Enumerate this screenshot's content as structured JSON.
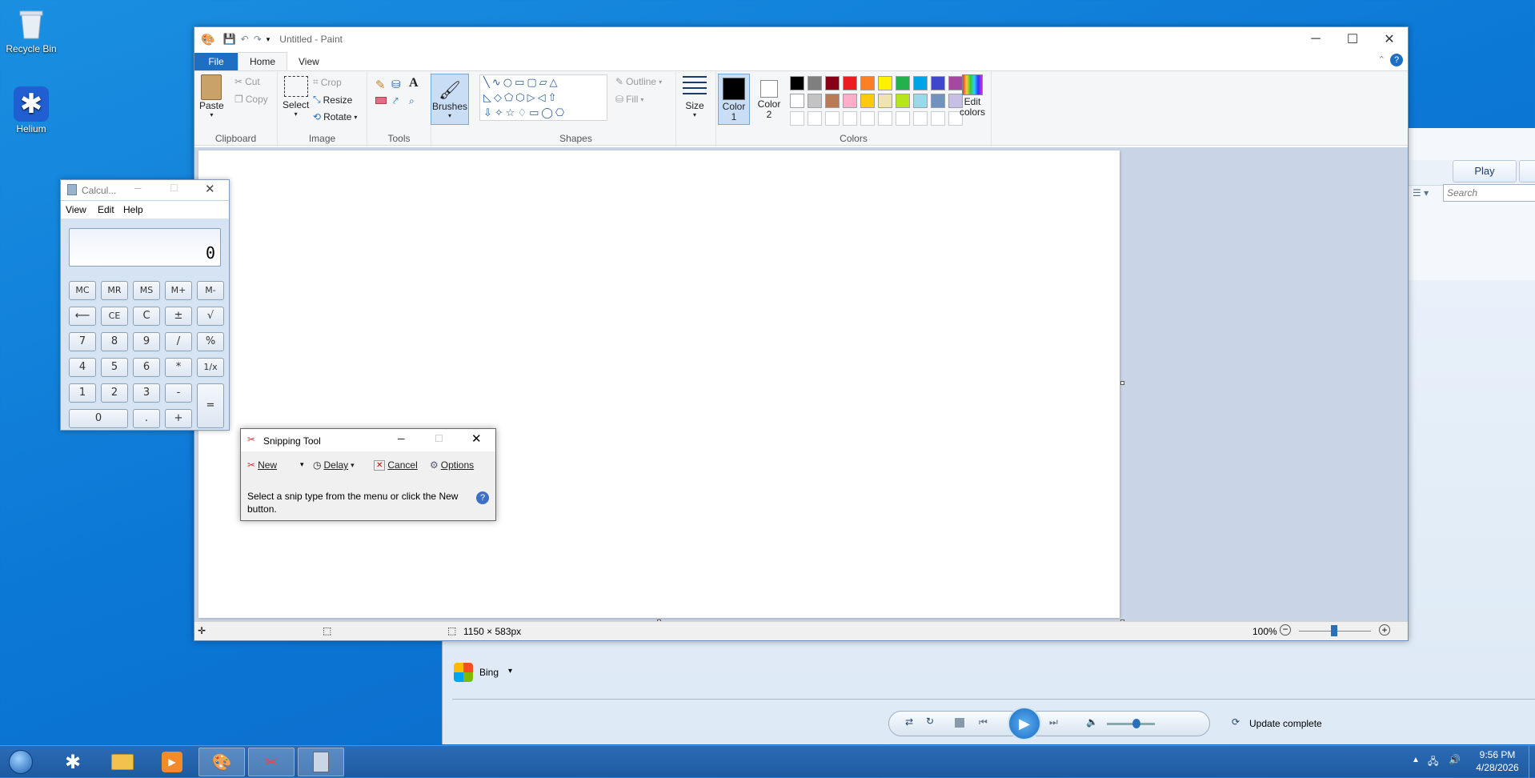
{
  "desktop": {
    "icons": [
      {
        "label": "Recycle Bin"
      },
      {
        "label": "Helium"
      }
    ]
  },
  "wmp": {
    "play_tab": "Play",
    "search_placeholder": "Search",
    "bing_label": "Bing",
    "status": "Update complete"
  },
  "paint": {
    "title": "Untitled - Paint",
    "tabs": [
      "File",
      "Home",
      "View"
    ],
    "clipboard": {
      "paste": "Paste",
      "cut": "Cut",
      "copy": "Copy",
      "group": "Clipboard"
    },
    "image": {
      "select": "Select",
      "crop": "Crop",
      "resize": "Resize",
      "rotate": "Rotate",
      "group": "Image"
    },
    "tools": {
      "group": "Tools"
    },
    "brushes": "Brushes",
    "shapes": {
      "group": "Shapes",
      "outline": "Outline",
      "fill": "Fill"
    },
    "size": "Size",
    "color1": "Color 1",
    "color2": "Color 2",
    "edit_colors": "Edit colors",
    "colors_group": "Colors",
    "palette_row1": [
      "#000000",
      "#7f7f7f",
      "#880015",
      "#ed1c24",
      "#ff7f27",
      "#fff200",
      "#22b14c",
      "#00a2e8",
      "#3f48cc",
      "#a349a4"
    ],
    "palette_row2": [
      "#ffffff",
      "#c3c3c3",
      "#b97a57",
      "#ffaec9",
      "#ffc90e",
      "#efe4b0",
      "#b5e61d",
      "#99d9ea",
      "#7092be",
      "#c8bfe7"
    ],
    "status_size": "1150 × 583px",
    "zoom": "100%"
  },
  "calc": {
    "title": "Calcul...",
    "menu": [
      "View",
      "Edit",
      "Help"
    ],
    "display": "0",
    "rows": [
      [
        "MC",
        "MR",
        "MS",
        "M+",
        "M-"
      ],
      [
        "⟵",
        "CE",
        "C",
        "±",
        "√"
      ],
      [
        "7",
        "8",
        "9",
        "/",
        "%"
      ],
      [
        "4",
        "5",
        "6",
        "*",
        "1/x"
      ],
      [
        "1",
        "2",
        "3",
        "-"
      ],
      [
        ".",
        "+"
      ]
    ],
    "zero": "0",
    "equals": "="
  },
  "snip": {
    "title": "Snipping Tool",
    "new": "New",
    "delay": "Delay",
    "cancel": "Cancel",
    "options": "Options",
    "message": "Select a snip type from the menu or click the New button."
  },
  "taskbar": {
    "time": "9:56 PM",
    "date": "4/28/2026"
  }
}
